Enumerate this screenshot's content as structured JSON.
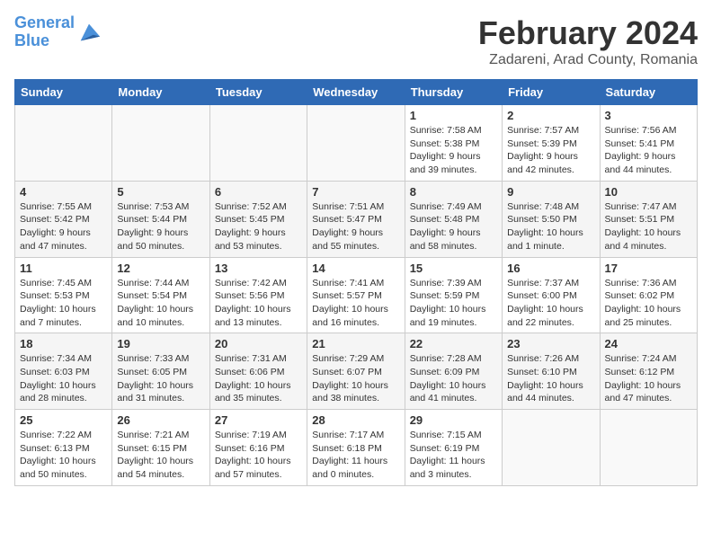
{
  "header": {
    "logo_line1": "General",
    "logo_line2": "Blue",
    "month": "February 2024",
    "location": "Zadareni, Arad County, Romania"
  },
  "days_of_week": [
    "Sunday",
    "Monday",
    "Tuesday",
    "Wednesday",
    "Thursday",
    "Friday",
    "Saturday"
  ],
  "weeks": [
    [
      {
        "day": "",
        "info": ""
      },
      {
        "day": "",
        "info": ""
      },
      {
        "day": "",
        "info": ""
      },
      {
        "day": "",
        "info": ""
      },
      {
        "day": "1",
        "info": "Sunrise: 7:58 AM\nSunset: 5:38 PM\nDaylight: 9 hours\nand 39 minutes."
      },
      {
        "day": "2",
        "info": "Sunrise: 7:57 AM\nSunset: 5:39 PM\nDaylight: 9 hours\nand 42 minutes."
      },
      {
        "day": "3",
        "info": "Sunrise: 7:56 AM\nSunset: 5:41 PM\nDaylight: 9 hours\nand 44 minutes."
      }
    ],
    [
      {
        "day": "4",
        "info": "Sunrise: 7:55 AM\nSunset: 5:42 PM\nDaylight: 9 hours\nand 47 minutes."
      },
      {
        "day": "5",
        "info": "Sunrise: 7:53 AM\nSunset: 5:44 PM\nDaylight: 9 hours\nand 50 minutes."
      },
      {
        "day": "6",
        "info": "Sunrise: 7:52 AM\nSunset: 5:45 PM\nDaylight: 9 hours\nand 53 minutes."
      },
      {
        "day": "7",
        "info": "Sunrise: 7:51 AM\nSunset: 5:47 PM\nDaylight: 9 hours\nand 55 minutes."
      },
      {
        "day": "8",
        "info": "Sunrise: 7:49 AM\nSunset: 5:48 PM\nDaylight: 9 hours\nand 58 minutes."
      },
      {
        "day": "9",
        "info": "Sunrise: 7:48 AM\nSunset: 5:50 PM\nDaylight: 10 hours\nand 1 minute."
      },
      {
        "day": "10",
        "info": "Sunrise: 7:47 AM\nSunset: 5:51 PM\nDaylight: 10 hours\nand 4 minutes."
      }
    ],
    [
      {
        "day": "11",
        "info": "Sunrise: 7:45 AM\nSunset: 5:53 PM\nDaylight: 10 hours\nand 7 minutes."
      },
      {
        "day": "12",
        "info": "Sunrise: 7:44 AM\nSunset: 5:54 PM\nDaylight: 10 hours\nand 10 minutes."
      },
      {
        "day": "13",
        "info": "Sunrise: 7:42 AM\nSunset: 5:56 PM\nDaylight: 10 hours\nand 13 minutes."
      },
      {
        "day": "14",
        "info": "Sunrise: 7:41 AM\nSunset: 5:57 PM\nDaylight: 10 hours\nand 16 minutes."
      },
      {
        "day": "15",
        "info": "Sunrise: 7:39 AM\nSunset: 5:59 PM\nDaylight: 10 hours\nand 19 minutes."
      },
      {
        "day": "16",
        "info": "Sunrise: 7:37 AM\nSunset: 6:00 PM\nDaylight: 10 hours\nand 22 minutes."
      },
      {
        "day": "17",
        "info": "Sunrise: 7:36 AM\nSunset: 6:02 PM\nDaylight: 10 hours\nand 25 minutes."
      }
    ],
    [
      {
        "day": "18",
        "info": "Sunrise: 7:34 AM\nSunset: 6:03 PM\nDaylight: 10 hours\nand 28 minutes."
      },
      {
        "day": "19",
        "info": "Sunrise: 7:33 AM\nSunset: 6:05 PM\nDaylight: 10 hours\nand 31 minutes."
      },
      {
        "day": "20",
        "info": "Sunrise: 7:31 AM\nSunset: 6:06 PM\nDaylight: 10 hours\nand 35 minutes."
      },
      {
        "day": "21",
        "info": "Sunrise: 7:29 AM\nSunset: 6:07 PM\nDaylight: 10 hours\nand 38 minutes."
      },
      {
        "day": "22",
        "info": "Sunrise: 7:28 AM\nSunset: 6:09 PM\nDaylight: 10 hours\nand 41 minutes."
      },
      {
        "day": "23",
        "info": "Sunrise: 7:26 AM\nSunset: 6:10 PM\nDaylight: 10 hours\nand 44 minutes."
      },
      {
        "day": "24",
        "info": "Sunrise: 7:24 AM\nSunset: 6:12 PM\nDaylight: 10 hours\nand 47 minutes."
      }
    ],
    [
      {
        "day": "25",
        "info": "Sunrise: 7:22 AM\nSunset: 6:13 PM\nDaylight: 10 hours\nand 50 minutes."
      },
      {
        "day": "26",
        "info": "Sunrise: 7:21 AM\nSunset: 6:15 PM\nDaylight: 10 hours\nand 54 minutes."
      },
      {
        "day": "27",
        "info": "Sunrise: 7:19 AM\nSunset: 6:16 PM\nDaylight: 10 hours\nand 57 minutes."
      },
      {
        "day": "28",
        "info": "Sunrise: 7:17 AM\nSunset: 6:18 PM\nDaylight: 11 hours\nand 0 minutes."
      },
      {
        "day": "29",
        "info": "Sunrise: 7:15 AM\nSunset: 6:19 PM\nDaylight: 11 hours\nand 3 minutes."
      },
      {
        "day": "",
        "info": ""
      },
      {
        "day": "",
        "info": ""
      }
    ]
  ]
}
